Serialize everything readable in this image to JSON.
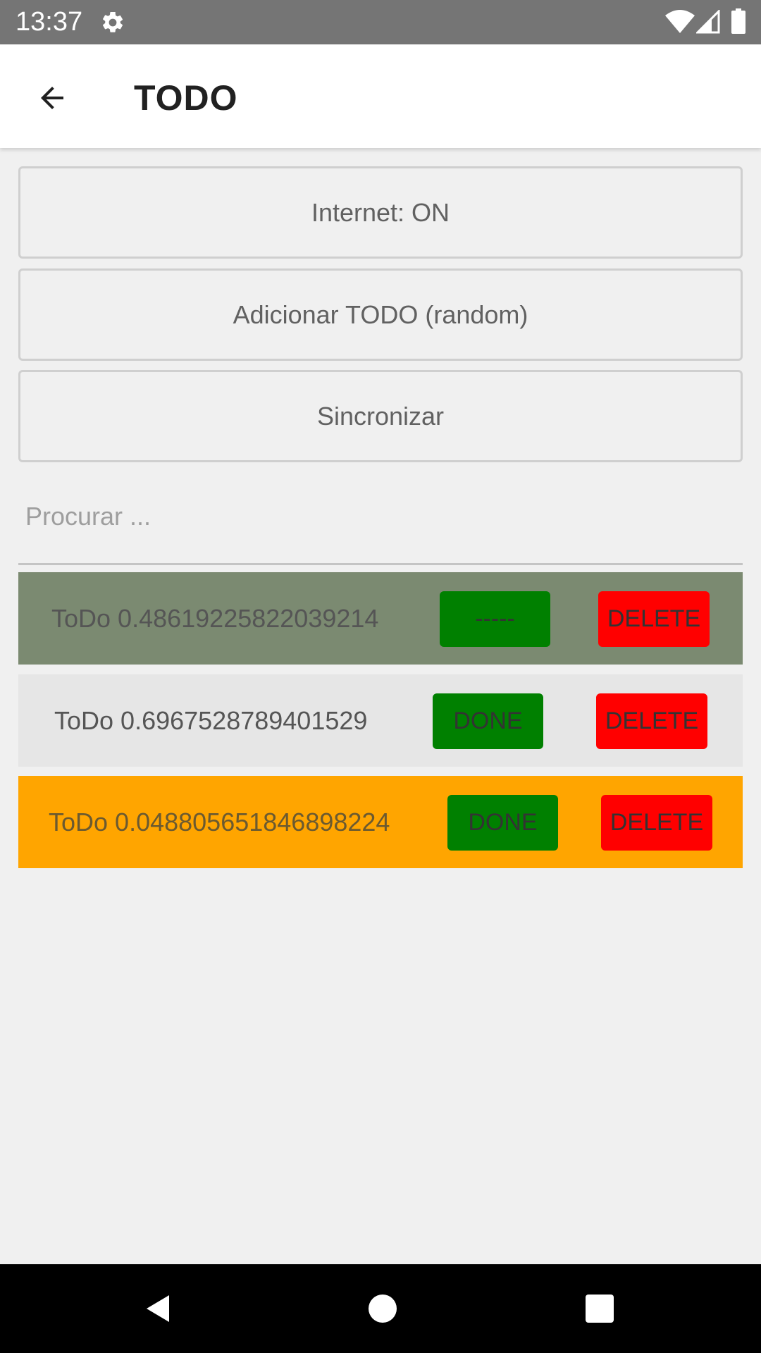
{
  "status_bar": {
    "time": "13:37",
    "icons": [
      "gear-icon",
      "wifi-icon",
      "signal-icon",
      "battery-icon"
    ]
  },
  "app_bar": {
    "title": "TODO",
    "back_icon": "arrow-left-icon"
  },
  "buttons": {
    "internet": "Internet: ON",
    "add": "Adicionar TODO (random)",
    "sync": "Sincronizar"
  },
  "search": {
    "placeholder": "Procurar ...",
    "value": ""
  },
  "todos": [
    {
      "text": "ToDo 0.48619225822039214",
      "action_label": "-----",
      "delete_label": "DELETE",
      "background": "#7b8a71"
    },
    {
      "text": "ToDo 0.6967528789401529",
      "action_label": "DONE",
      "delete_label": "DELETE",
      "background": "#e6e6e6"
    },
    {
      "text": "ToDo 0.048805651846898224",
      "action_label": "DONE",
      "delete_label": "DELETE",
      "background": "#ffa500"
    }
  ],
  "colors": {
    "done_button": "#008000",
    "delete_button": "#ff0000",
    "status_bar": "#757575",
    "nav_bar": "#000000"
  },
  "nav_bar": {
    "icons": [
      "nav-back-icon",
      "nav-home-icon",
      "nav-recents-icon"
    ]
  }
}
